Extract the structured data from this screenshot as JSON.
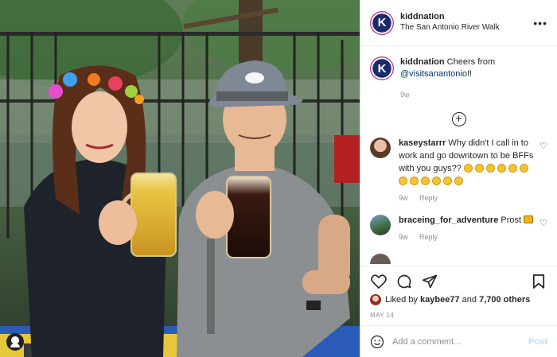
{
  "post": {
    "username": "kiddnation",
    "location": "The San Antonio River Walk",
    "avatar_letter": "K",
    "more_icon": "more-horizontal-icon"
  },
  "caption": {
    "username": "kiddnation",
    "text": "Cheers from",
    "mention": "@visitsanantonio",
    "suffix": "!!",
    "age": "9w"
  },
  "comments": [
    {
      "username": "kaseystarrr",
      "text": "Why didn't I call in to work and go downtown to be BFFs with you guys??",
      "age": "9w",
      "reply_label": "Reply"
    },
    {
      "username": "braceing_for_adventure",
      "text": "Prost",
      "age": "9w",
      "reply_label": "Reply"
    }
  ],
  "actions": {
    "like_icon": "heart-icon",
    "comment_icon": "comment-icon",
    "share_icon": "share-icon",
    "save_icon": "bookmark-icon"
  },
  "likes": {
    "prefix": "Liked by",
    "user": "kaybee77",
    "joiner": "and",
    "count": "7,700 others"
  },
  "date": "MAY 14",
  "composer": {
    "placeholder": "Add a comment...",
    "post_label": "Post"
  }
}
